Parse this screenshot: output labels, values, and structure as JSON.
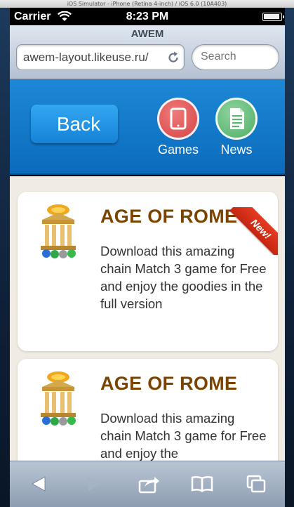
{
  "simulator": {
    "title": "iOS Simulator - iPhone (Retina 4-inch) / iOS 6.0 (10A403)"
  },
  "status_bar": {
    "carrier": "Carrier",
    "time": "8:23 PM"
  },
  "browser": {
    "page_title": "AWEM",
    "url": "awem-layout.likeuse.ru/",
    "search_placeholder": "Search"
  },
  "header": {
    "back_label": "Back",
    "nav": [
      {
        "label": "Games",
        "icon": "tablet-icon",
        "color": "#de5656"
      },
      {
        "label": "News",
        "icon": "document-icon",
        "color": "#5cb672"
      }
    ]
  },
  "games": [
    {
      "title": "AGE OF ROME",
      "description": "Download this amazing chain Match 3 game for Free and enjoy the goodies in the full version",
      "badge": "New!"
    },
    {
      "title": "AGE OF ROME",
      "description": "Download this amazing chain Match 3 game for Free and enjoy the"
    }
  ],
  "toolbar": {
    "items": [
      "back-arrow-icon",
      "forward-arrow-icon",
      "share-icon",
      "bookmarks-icon",
      "tabs-icon"
    ]
  },
  "colors": {
    "header_blue": "#1478c8",
    "title_brown": "#7a4400",
    "ribbon_red": "#d8301a",
    "content_bg": "#f0ebe3"
  }
}
